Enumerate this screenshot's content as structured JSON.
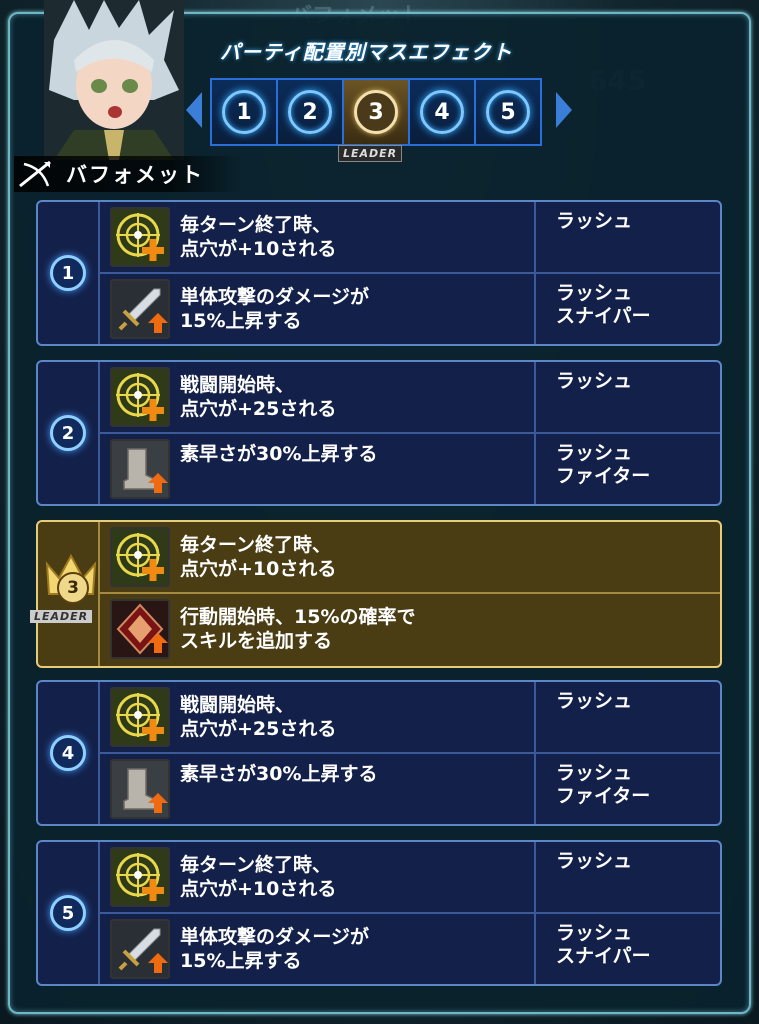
{
  "header": {
    "character_name": "バフォメット",
    "tabs_title": "パーティ配置別マスエフェクト",
    "leader_tag": "LEADER",
    "tabs": [
      {
        "label": "1",
        "active": false
      },
      {
        "label": "2",
        "active": false
      },
      {
        "label": "3",
        "active": true
      },
      {
        "label": "4",
        "active": false
      },
      {
        "label": "5",
        "active": false
      }
    ]
  },
  "background_ghost": {
    "title": "バフォメット",
    "number": "645"
  },
  "groups": [
    {
      "position": "1",
      "leader": false,
      "effects": [
        {
          "icon": "target-plus-icon",
          "description": "毎ターン終了時、\n点穴が+10される",
          "condition": "ラッシュ"
        },
        {
          "icon": "sword-up-icon",
          "description": "単体攻撃のダメージが\n15%上昇する",
          "condition": "ラッシュ\nスナイパー"
        }
      ]
    },
    {
      "position": "2",
      "leader": false,
      "effects": [
        {
          "icon": "target-plus-icon",
          "description": "戦闘開始時、\n点穴が+25される",
          "condition": "ラッシュ"
        },
        {
          "icon": "boot-up-icon",
          "description": "素早さが30%上昇する",
          "condition": "ラッシュ\nファイター"
        }
      ]
    },
    {
      "position": "3",
      "leader": true,
      "leader_label": "LEADER",
      "effects": [
        {
          "icon": "target-plus-icon",
          "description": "毎ターン終了時、\n点穴が+10される",
          "condition": ""
        },
        {
          "icon": "skill-up-icon",
          "description": "行動開始時、15%の確率で\nスキルを追加する",
          "condition": ""
        }
      ]
    },
    {
      "position": "4",
      "leader": false,
      "effects": [
        {
          "icon": "target-plus-icon",
          "description": "戦闘開始時、\n点穴が+25される",
          "condition": "ラッシュ"
        },
        {
          "icon": "boot-up-icon",
          "description": "素早さが30%上昇する",
          "condition": "ラッシュ\nファイター"
        }
      ]
    },
    {
      "position": "5",
      "leader": false,
      "effects": [
        {
          "icon": "target-plus-icon",
          "description": "毎ターン終了時、\n点穴が+10される",
          "condition": "ラッシュ"
        },
        {
          "icon": "sword-up-icon",
          "description": "単体攻撃のダメージが\n15%上昇する",
          "condition": "ラッシュ\nスナイパー"
        }
      ]
    }
  ]
}
